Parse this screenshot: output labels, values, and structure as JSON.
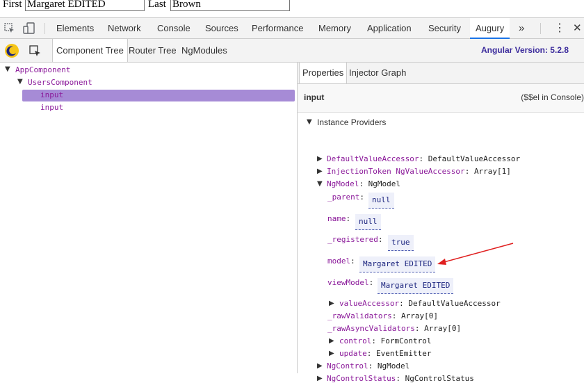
{
  "page": {
    "first_label": "First",
    "first_value": "Margaret EDITED",
    "last_label": "Last",
    "last_value": "Brown"
  },
  "devtools": {
    "tabs": [
      "Elements",
      "Network",
      "Console",
      "Sources",
      "Performance",
      "Memory",
      "Application",
      "Security",
      "Augury"
    ],
    "active_tab": "Augury",
    "more_tabs": "»",
    "menu_icon": "⋮",
    "close_icon": "✕"
  },
  "augury": {
    "subtabs": [
      "Component Tree",
      "Router Tree",
      "NgModules"
    ],
    "active_subtab": "Component Tree",
    "version": "Angular Version: 5.2.8"
  },
  "tree": {
    "nodes": [
      {
        "label": "AppComponent",
        "expanded": true
      },
      {
        "label": "UsersComponent",
        "expanded": true
      },
      {
        "label": "input",
        "selected": true
      },
      {
        "label": "input"
      }
    ]
  },
  "details": {
    "tabs": [
      "Properties",
      "Injector Graph"
    ],
    "active_tab": "Properties",
    "selected_name": "input",
    "console_hint": "($$el in Console)",
    "section_title": "Instance Providers",
    "providers": [
      {
        "key": "DefaultValueAccessor",
        "value": "DefaultValueAccessor"
      },
      {
        "key": "InjectionToken NgValueAccessor",
        "value": "Array[1]"
      },
      {
        "key": "NgModel",
        "value": "NgModel"
      }
    ],
    "ngmodel_props": [
      {
        "key": "_parent",
        "value": "null"
      },
      {
        "key": "name",
        "value": "null"
      },
      {
        "key": "_registered",
        "value": "true"
      },
      {
        "key": "model",
        "value": "Margaret EDITED"
      },
      {
        "key": "viewModel",
        "value": "Margaret EDITED"
      }
    ],
    "ngmodel_more": [
      {
        "key": "valueAccessor",
        "value": "DefaultValueAccessor"
      },
      {
        "key": "_rawValidators",
        "value": "Array[0]"
      },
      {
        "key": "_rawAsyncValidators",
        "value": "Array[0]"
      },
      {
        "key": "control",
        "value": "FormControl"
      },
      {
        "key": "update",
        "value": "EventEmitter"
      }
    ],
    "providers_tail": [
      {
        "key": "NgControl",
        "value": "NgModel"
      },
      {
        "key": "NgControlStatus",
        "value": "NgControlStatus"
      }
    ]
  },
  "colors": {
    "accent": "#1a73e8",
    "selected_row": "#a68bd6",
    "key": "#8b1a9a",
    "arrow": "#e02020"
  }
}
